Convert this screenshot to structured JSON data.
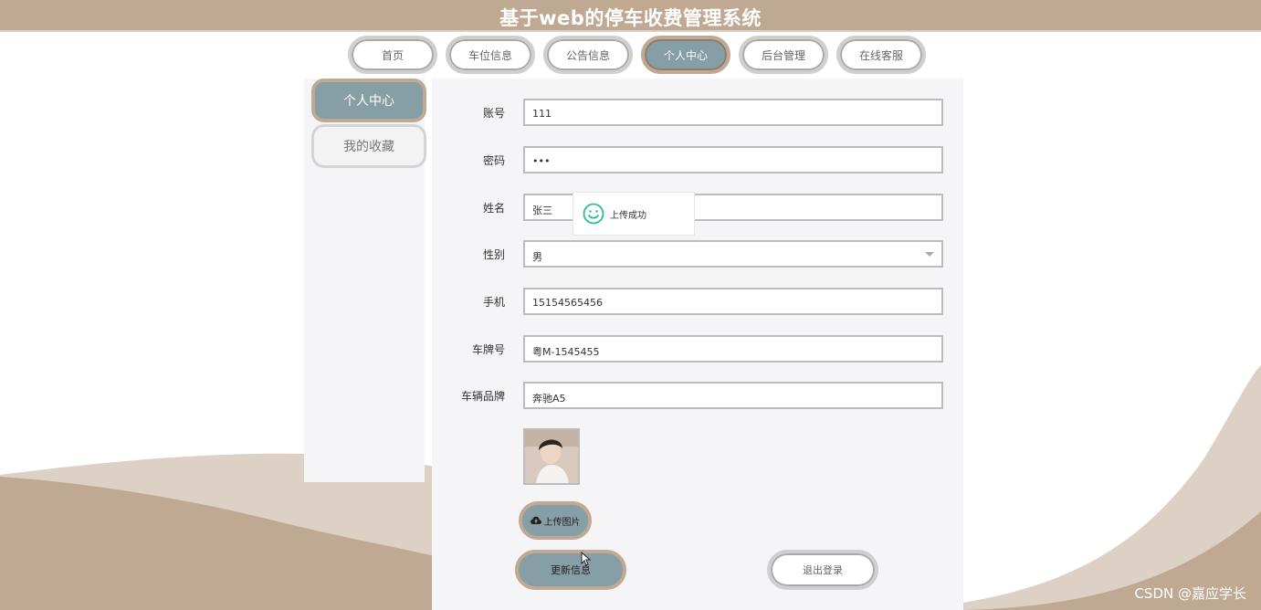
{
  "app": {
    "title": "基于web的停车收费管理系统"
  },
  "nav": {
    "items": [
      {
        "label": "首页",
        "active": false
      },
      {
        "label": "车位信息",
        "active": false
      },
      {
        "label": "公告信息",
        "active": false
      },
      {
        "label": "个人中心",
        "active": true
      },
      {
        "label": "后台管理",
        "active": false
      },
      {
        "label": "在线客服",
        "active": false
      }
    ]
  },
  "sidebar": {
    "items": [
      {
        "label": "个人中心",
        "active": true
      },
      {
        "label": "我的收藏",
        "active": false
      }
    ]
  },
  "form": {
    "account": {
      "label": "账号",
      "value": "111"
    },
    "password": {
      "label": "密码",
      "value": "•••"
    },
    "name": {
      "label": "姓名",
      "value": "张三"
    },
    "gender": {
      "label": "性别",
      "value": "男"
    },
    "phone": {
      "label": "手机",
      "value": "15154565456"
    },
    "plate": {
      "label": "车牌号",
      "value": "粤M-1545455"
    },
    "brand": {
      "label": "车辆品牌",
      "value": "奔驰A5"
    }
  },
  "actions": {
    "upload_label": "上传图片",
    "update_label": "更新信息",
    "logout_label": "退出登录"
  },
  "toast": {
    "message": "上传成功"
  },
  "watermark": "CSDN @嘉应学长",
  "colors": {
    "header": "#bfa993",
    "accent": "#869ea6",
    "border_accent": "#bfa993",
    "success": "#2bbd92"
  },
  "icons": {
    "toast": "smile-icon",
    "upload": "cloud-upload-icon",
    "select": "chevron-down-icon"
  }
}
